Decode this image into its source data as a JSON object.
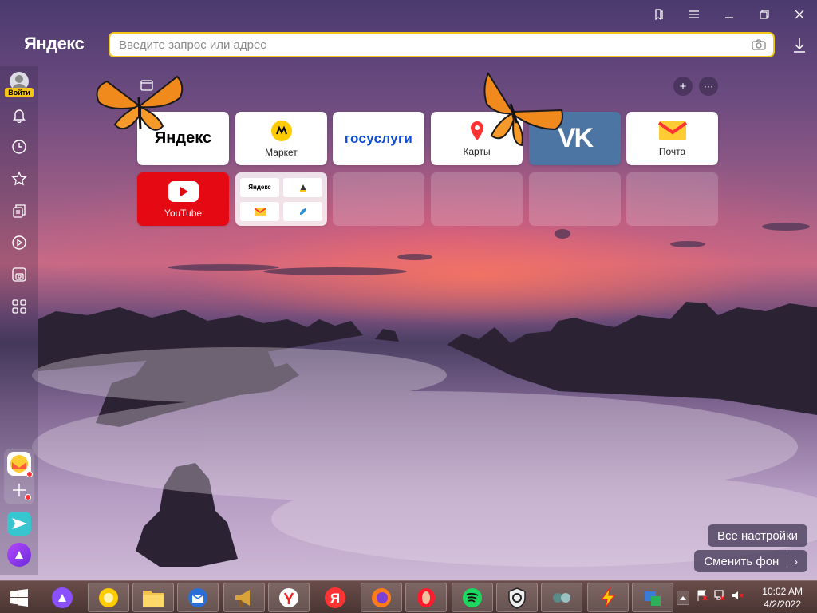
{
  "browser": {
    "logo_text": "Яндекс",
    "search_placeholder": "Введите запрос или адрес",
    "window_controls": [
      "bookmarks-icon",
      "menu-icon",
      "minimize-icon",
      "restore-icon",
      "close-icon"
    ]
  },
  "sidebar": {
    "login_label": "Войти",
    "items": [
      "bell-icon",
      "history-icon",
      "star-icon",
      "collections-icon",
      "video-icon",
      "screenshot-icon",
      "apps-grid-icon"
    ],
    "apps": [
      "mail-app-icon",
      "add-app-icon",
      "messenger-icon",
      "alice-icon"
    ]
  },
  "tiles": [
    {
      "label": "",
      "logo": "Яндекс"
    },
    {
      "label": "Маркет"
    },
    {
      "label": "",
      "logo": "госуслуги"
    },
    {
      "label": "Карты"
    },
    {
      "label": "",
      "logo": "VK"
    },
    {
      "label": "Почта"
    },
    {
      "label": "YouTube"
    },
    {
      "folder_items": [
        "Яндекс",
        "",
        "",
        ""
      ]
    }
  ],
  "actions": {
    "all_settings": "Все настройки",
    "change_background": "Сменить фон",
    "add_tile": "+",
    "more": "···"
  },
  "taskbar": {
    "time": "10:02 AM",
    "date": "4/2/2022"
  },
  "colors": {
    "accent": "#f5c518",
    "vk": "#4c75a3",
    "youtube": "#e50914",
    "taskbar": "#5a403d"
  }
}
